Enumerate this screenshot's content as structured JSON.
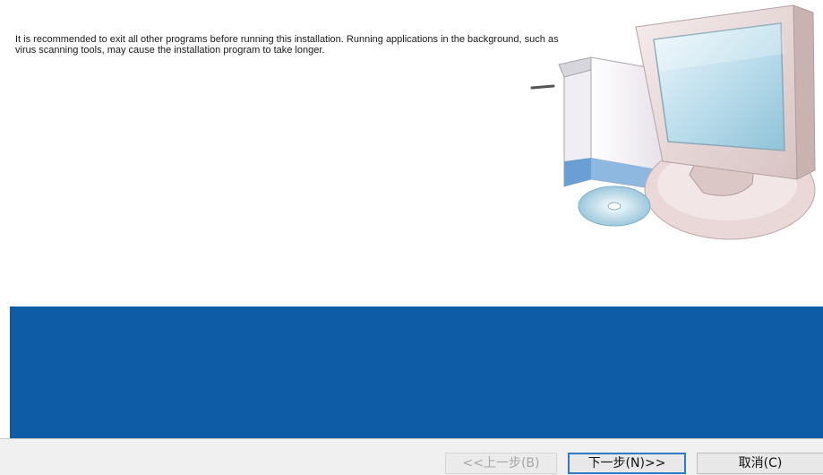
{
  "message": "It is recommended to exit all other programs before running this installation. Running applications in the background, such as virus scanning tools, may cause the installation program to take longer.",
  "buttons": {
    "back_label": "<<上一步(B)",
    "next_label": "下一步(N)>>",
    "cancel_label": "取消(C)",
    "back_enabled": false
  },
  "colors": {
    "band": "#0d5ca5",
    "footer": "#f0f0f0",
    "default_button_border": "#2f79c8"
  },
  "illustration": "computer-with-cd-icon"
}
